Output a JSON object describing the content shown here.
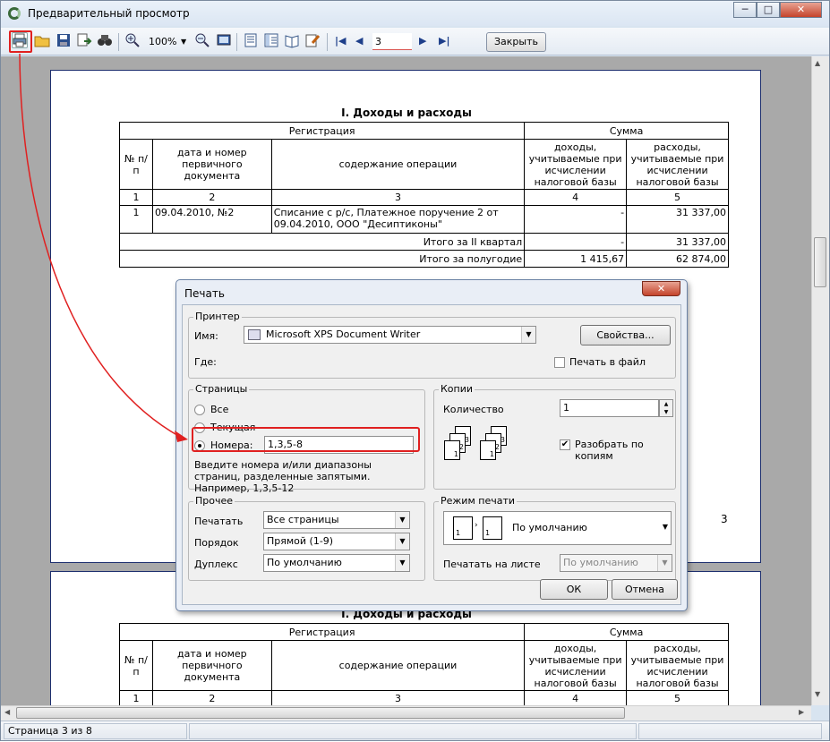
{
  "window": {
    "title": "Предварительный просмотр",
    "min": "─",
    "max": "□",
    "close": "✕"
  },
  "toolbar": {
    "zoom": "100%",
    "page": "3",
    "close_label": "Закрыть",
    "nav_first": "|◀",
    "nav_prev": "◀",
    "nav_next": "▶",
    "nav_last": "▶|"
  },
  "report": {
    "section_title": "I. Доходы и расходы",
    "hdr_registration": "Регистрация",
    "hdr_sum": "Сумма",
    "col_num": "№ п/п",
    "col_doc": "дата и номер первичного документа",
    "col_op": "содержание операции",
    "col_income": "доходы, учитываемые при исчислении налоговой базы",
    "col_expense": "расходы, учитываемые при исчислении налоговой базы",
    "idx": [
      "1",
      "2",
      "3",
      "4",
      "5"
    ],
    "row1": {
      "num": "1",
      "doc": "09.04.2010, №2",
      "op": "Списание с р/с, Платежное поручение 2 от 09.04.2010, ООО \"Десиптиконы\"",
      "income": "-",
      "expense": "31 337,00"
    },
    "total_q": {
      "label": "Итого за II квартал",
      "income": "-",
      "expense": "31 337,00"
    },
    "total_h": {
      "label": "Итого за полугодие",
      "income": "1 415,67",
      "expense": "62 874,00"
    },
    "page_number": "3"
  },
  "print_dialog": {
    "title": "Печать",
    "close": "✕",
    "printer_group": "Принтер",
    "name_label": "Имя:",
    "printer_name": "Microsoft XPS Document Writer",
    "properties_button": "Свойства...",
    "where_label": "Где:",
    "print_to_file": "Печать в файл",
    "pages_group": "Страницы",
    "all": "Все",
    "current": "Текущая",
    "numbers": "Номера:",
    "numbers_value": "1,3,5-8",
    "hint": "Введите номера и/или диапазоны страниц, разделенные запятыми. Например, 1,3,5-12",
    "copies_group": "Копии",
    "quantity_label": "Количество",
    "quantity": "1",
    "collate": "Разобрать по копиям",
    "collate_checked": true,
    "other_group": "Прочее",
    "print_label": "Печатать",
    "print_value": "Все страницы",
    "order_label": "Порядок",
    "order_value": "Прямой (1-9)",
    "duplex_label": "Дуплекс",
    "duplex_value": "По умолчанию",
    "mode_group": "Режим печати",
    "mode_value": "По умолчанию",
    "sheet_label": "Печатать на листе",
    "sheet_value": "По умолчанию",
    "ok": "ОК",
    "cancel": "Отмена"
  },
  "status": {
    "page_info": "Страница 3 из 8"
  },
  "annotation_color": "#e02020"
}
